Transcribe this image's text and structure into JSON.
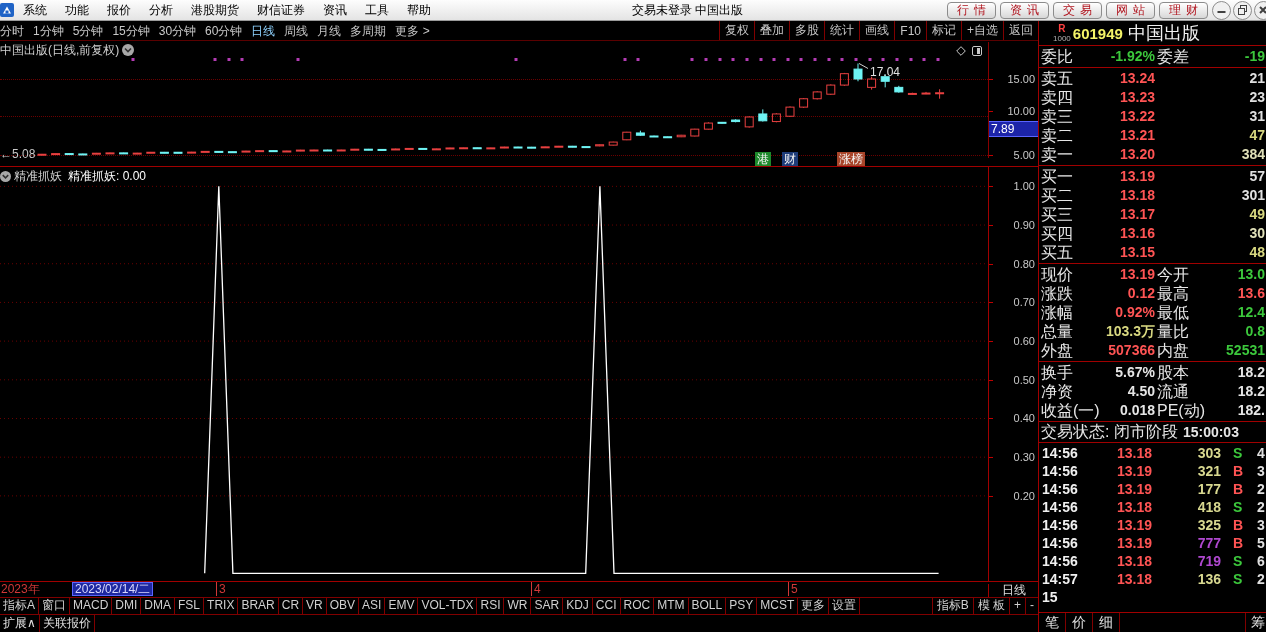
{
  "menu_bar": {
    "items": [
      "系统",
      "功能",
      "报价",
      "分析",
      "港股期货",
      "财信证券",
      "资讯",
      "工具",
      "帮助"
    ],
    "title": "交易未登录 中国出版",
    "quick_buttons": [
      "行情",
      "资讯",
      "交易",
      "网站",
      "理财"
    ]
  },
  "period_tabs": [
    {
      "label": "分时",
      "selected": false
    },
    {
      "label": "1分钟",
      "selected": false
    },
    {
      "label": "5分钟",
      "selected": false
    },
    {
      "label": "15分钟",
      "selected": false
    },
    {
      "label": "30分钟",
      "selected": false
    },
    {
      "label": "60分钟",
      "selected": false
    },
    {
      "label": "日线",
      "selected": true
    },
    {
      "label": "周线",
      "selected": false
    },
    {
      "label": "月线",
      "selected": false
    },
    {
      "label": "多周期",
      "selected": false
    },
    {
      "label": "更多 >",
      "selected": false
    }
  ],
  "tools": [
    "复权",
    "叠加",
    "多股",
    "统计",
    "画线",
    "F10",
    "标记",
    "+自选",
    "返回"
  ],
  "price_chart": {
    "title": "中国出版(日线,前复权)",
    "price_labels": [
      "15.00",
      "10.00",
      "5.00"
    ],
    "cursor_price": "7.89",
    "high_label": "17.04",
    "low_label": "←5.08",
    "badges": [
      {
        "text": "港",
        "color": "#1d8a2c"
      },
      {
        "text": "财",
        "color": "#1e3c78"
      },
      {
        "text": "涨榜",
        "color": "#a8452a"
      }
    ]
  },
  "indicator": {
    "reading": "精准抓妖: 0.00",
    "chart_data": {
      "type": "line",
      "grid": true,
      "ylim": [
        -0.02,
        1.05
      ],
      "yticks": [
        {
          "value": 1,
          "label": "1.00"
        },
        {
          "value": 0.9,
          "label": "0.90"
        },
        {
          "value": 0.8,
          "label": "0.80"
        },
        {
          "value": 0.7,
          "label": "0.70"
        },
        {
          "value": 0.6,
          "label": "0.60"
        },
        {
          "value": 0.5,
          "label": "0.50"
        },
        {
          "value": 0.4,
          "label": "0.40"
        },
        {
          "value": 0.3,
          "label": "0.30"
        },
        {
          "value": 0.2,
          "label": "0.20"
        }
      ],
      "series": [
        {
          "name": "精准抓妖",
          "color": "#ffffff",
          "values": [
            null,
            null,
            null,
            null,
            null,
            null,
            null,
            null,
            null,
            null,
            null,
            null,
            null,
            null,
            0,
            1,
            0,
            0,
            0,
            0,
            0,
            0,
            0,
            0,
            0,
            0,
            0,
            0,
            0,
            0,
            0,
            0,
            0,
            0,
            0,
            0,
            0,
            0,
            0,
            0,
            0,
            0,
            1,
            0,
            0,
            0,
            0,
            0,
            0,
            0,
            0,
            0,
            0,
            0,
            0,
            0,
            0,
            0,
            0,
            0,
            0,
            0,
            0,
            0,
            0,
            0,
            0,
            null,
            null,
            null
          ]
        }
      ]
    }
  },
  "time_axis": {
    "year": "2023年",
    "cursor_date": "2023/02/14/二",
    "months": [
      "3",
      "4",
      "5"
    ],
    "period": "日线"
  },
  "indicator_tabs": {
    "left": [
      "指标A",
      "窗口",
      "MACD",
      "DMI",
      "DMA",
      "FSL",
      "TRIX",
      "BRAR",
      "CR",
      "VR",
      "OBV",
      "ASI",
      "EMV",
      "VOL-TDX",
      "RSI",
      "WR",
      "SAR",
      "KDJ",
      "CCI",
      "ROC",
      "MTM",
      "BOLL",
      "PSY",
      "MCST",
      "更多",
      "设置"
    ],
    "right": [
      "指标B",
      "模 板",
      "+",
      "-"
    ]
  },
  "bottom_tabs": [
    "扩展∧",
    "关联报价"
  ],
  "quote": {
    "rank_mark": "R",
    "rank_value": "1000",
    "code": "601949",
    "name": "中国出版",
    "ratio": [
      {
        "label": "委比",
        "value": "-1.92%",
        "falling": true
      },
      {
        "label": "委差",
        "value": "-19",
        "falling": true
      }
    ],
    "asks": [
      {
        "label": "卖五",
        "price": "13.24",
        "volume": "21",
        "color": "#e0e0e0"
      },
      {
        "label": "卖四",
        "price": "13.23",
        "volume": "23",
        "color": "#e0e0e0"
      },
      {
        "label": "卖三",
        "price": "13.22",
        "volume": "31",
        "color": "#e0e0e0"
      },
      {
        "label": "卖二",
        "price": "13.21",
        "volume": "47",
        "color": "#d8d880"
      },
      {
        "label": "卖一",
        "price": "13.20",
        "volume": "384",
        "color": "#e0e0b8"
      }
    ],
    "bids": [
      {
        "label": "买一",
        "price": "13.19",
        "volume": "57",
        "color": "#e0e0e0"
      },
      {
        "label": "买二",
        "price": "13.18",
        "volume": "301",
        "color": "#e0e0e0"
      },
      {
        "label": "买三",
        "price": "13.17",
        "volume": "49",
        "color": "#d8d880"
      },
      {
        "label": "买四",
        "price": "13.16",
        "volume": "30",
        "color": "#e0e0b8"
      },
      {
        "label": "买五",
        "price": "13.15",
        "volume": "48",
        "color": "#d8d880"
      }
    ],
    "stats": [
      [
        {
          "label": "现价",
          "value": "13.19",
          "color": "#ff5454"
        },
        {
          "label": "今开",
          "value": "13.0",
          "color": "#3cc83c"
        }
      ],
      [
        {
          "label": "涨跌",
          "value": "0.12",
          "color": "#ff5454"
        },
        {
          "label": "最高",
          "value": "13.6",
          "color": "#ff5454"
        }
      ],
      [
        {
          "label": "涨幅",
          "value": "0.92%",
          "color": "#ff5454"
        },
        {
          "label": "最低",
          "value": "12.4",
          "color": "#3cc83c"
        }
      ],
      [
        {
          "label": "总量",
          "value": "103.3万",
          "color": "#d8d880"
        },
        {
          "label": "量比",
          "value": "0.8",
          "color": "#3cc83c"
        }
      ],
      [
        {
          "label": "外盘",
          "value": "507366",
          "color": "#ff5454"
        },
        {
          "label": "内盘",
          "value": "52531",
          "color": "#3cc83c"
        }
      ]
    ],
    "fundamentals": [
      [
        {
          "label": "换手",
          "value": "5.67%"
        },
        {
          "label": "股本",
          "value": "18.2"
        }
      ],
      [
        {
          "label": "净资",
          "value": "4.50"
        },
        {
          "label": "流通",
          "value": "18.2"
        }
      ],
      [
        {
          "label": "收益(一)",
          "value": "0.018"
        },
        {
          "label": "PE(动)",
          "value": "182."
        }
      ]
    ],
    "status": {
      "label": "交易状态: 闭市阶段",
      "time": "15:00:03"
    },
    "ticks": [
      {
        "time": "14:56",
        "price": "13.18",
        "volume": "303",
        "large": false,
        "side": "S",
        "kind": "sell",
        "extra": "4"
      },
      {
        "time": "14:56",
        "price": "13.19",
        "volume": "321",
        "large": false,
        "side": "B",
        "kind": "buy",
        "extra": "3"
      },
      {
        "time": "14:56",
        "price": "13.19",
        "volume": "177",
        "large": false,
        "side": "B",
        "kind": "buy",
        "extra": "2"
      },
      {
        "time": "14:56",
        "price": "13.18",
        "volume": "418",
        "large": false,
        "side": "S",
        "kind": "sell",
        "extra": "2"
      },
      {
        "time": "14:56",
        "price": "13.19",
        "volume": "325",
        "large": false,
        "side": "B",
        "kind": "buy",
        "extra": "3"
      },
      {
        "time": "14:56",
        "price": "13.19",
        "volume": "777",
        "large": true,
        "side": "B",
        "kind": "buy",
        "extra": "5"
      },
      {
        "time": "14:56",
        "price": "13.18",
        "volume": "719",
        "large": true,
        "side": "S",
        "kind": "sell",
        "extra": "6"
      },
      {
        "time": "14:57",
        "price": "13.18",
        "volume": "136",
        "large": false,
        "side": "S",
        "kind": "sell",
        "extra": "2"
      },
      {
        "time": "15"
      }
    ],
    "tabs": [
      "笔",
      "价",
      "细",
      "筹"
    ]
  }
}
